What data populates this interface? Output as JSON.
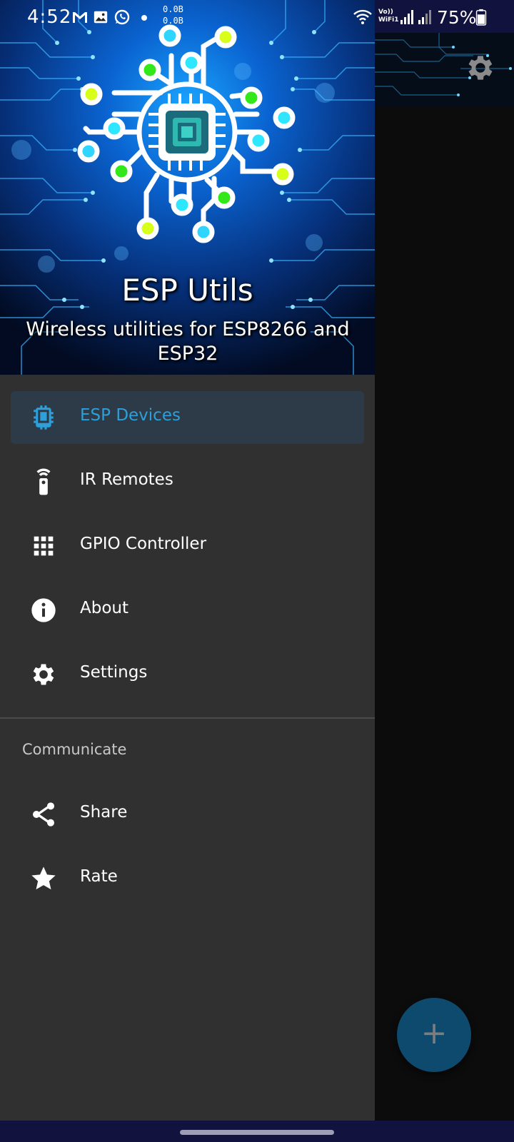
{
  "status_bar": {
    "time": "4:52",
    "net_speed_up": "0.0B",
    "net_speed_down": "0.0B",
    "vowifi_line1": "Vo))",
    "vowifi_line2": "WiFi1",
    "battery": "75%",
    "icons": [
      "gmail-icon",
      "gallery-icon",
      "whatsapp-icon",
      "dot-icon",
      "wifi-icon",
      "signal-icon",
      "signal-icon",
      "battery-icon"
    ]
  },
  "drawer": {
    "header": {
      "title": "ESP Utils",
      "subtitle": "Wireless utilities for ESP8266 and ESP32"
    },
    "items": [
      {
        "label": "ESP Devices",
        "icon": "chip-icon",
        "active": true
      },
      {
        "label": "IR Remotes",
        "icon": "remote-icon",
        "active": false
      },
      {
        "label": "GPIO Controller",
        "icon": "grid-icon",
        "active": false
      },
      {
        "label": "About",
        "icon": "info-icon",
        "active": false
      },
      {
        "label": "Settings",
        "icon": "gear-icon",
        "active": false
      }
    ],
    "section_title": "Communicate",
    "section_items": [
      {
        "label": "Share",
        "icon": "share-icon"
      },
      {
        "label": "Rate",
        "icon": "star-icon"
      }
    ]
  },
  "app": {
    "toolbar_action_icon": "gear-icon",
    "fab_icon": "plus-icon",
    "fab_glyph": "+"
  },
  "colors": {
    "drawer_bg": "#303030",
    "active_item_bg": "#2d3b48",
    "active_item_text": "#2d9fda",
    "fab": "#0e4a6e",
    "system_bar": "#12123f"
  }
}
